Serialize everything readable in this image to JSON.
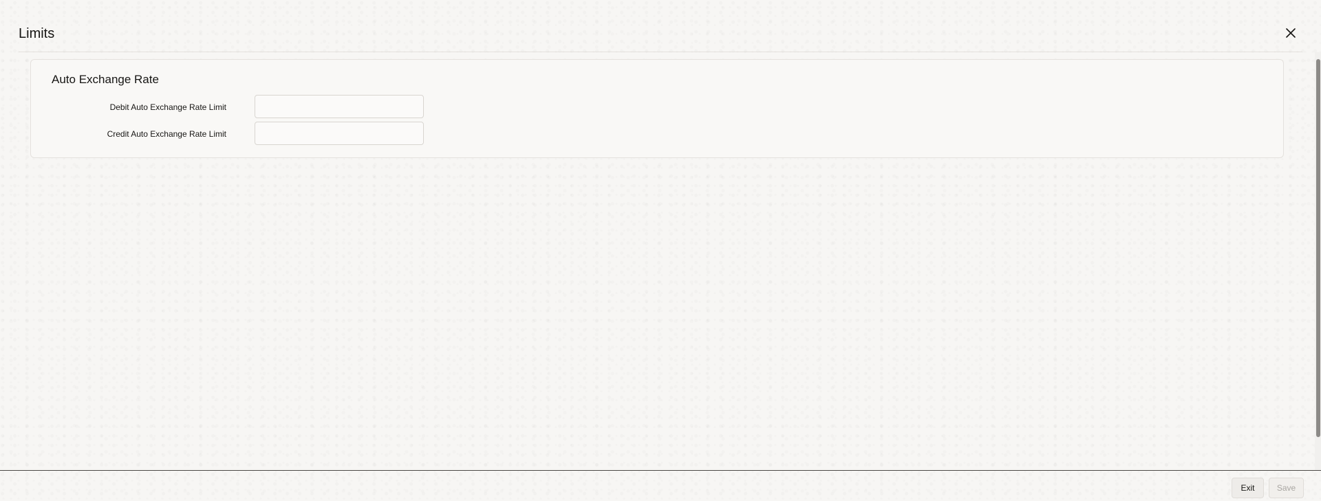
{
  "dialog": {
    "title": "Limits",
    "close_icon": "close-icon"
  },
  "section": {
    "title": "Auto Exchange Rate",
    "fields": [
      {
        "label": "Debit Auto Exchange Rate Limit",
        "value": "",
        "placeholder": ""
      },
      {
        "label": "Credit Auto Exchange Rate Limit",
        "value": "",
        "placeholder": ""
      }
    ]
  },
  "footer": {
    "exit_label": "Exit",
    "save_label": "Save"
  },
  "colors": {
    "background": "#f7f6f4",
    "panel": "#f9f8f6",
    "text": "#161513",
    "disabled_text": "#a9a6a2"
  }
}
